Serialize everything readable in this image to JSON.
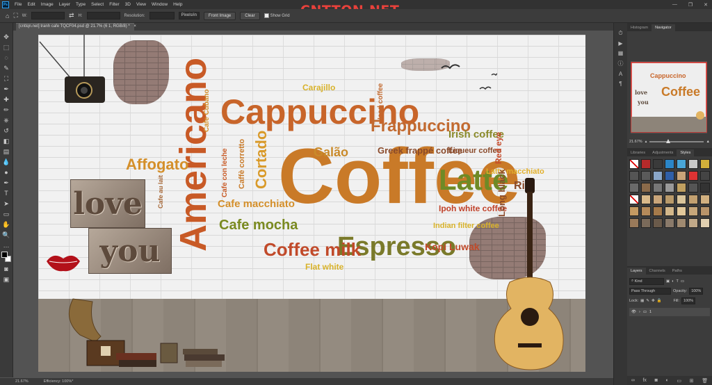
{
  "menu": [
    "File",
    "Edit",
    "Image",
    "Layer",
    "Type",
    "Select",
    "Filter",
    "3D",
    "View",
    "Window",
    "Help"
  ],
  "watermark": "CNTTQN.NET",
  "options": {
    "w_label": "W:",
    "h_label": "H:",
    "resolution_label": "Resolution:",
    "units": "Pixels/in",
    "front_image": "Front Image",
    "clear": "Clear",
    "show_grid": "Show Grid"
  },
  "document": {
    "tab_title": "[cnttqn.net] tranh cafe TQCF04.psd @ 21.7% (6 1, RGB/8) *",
    "close": "×"
  },
  "status": {
    "zoom": "21.67%",
    "efficiency": "Efficiency: 100%*"
  },
  "panels": {
    "top_tabs": [
      "Histogram",
      "Navigator"
    ],
    "zoom": "21.67%",
    "mid_tabs": [
      "Libraries",
      "Adjustments",
      "Styles"
    ],
    "layer_tabs": [
      "Layers",
      "Channels",
      "Paths"
    ],
    "kind": "Kind",
    "blend": "Pass Through",
    "opacity_label": "Opacity:",
    "opacity": "100%",
    "lock_label": "Lock:",
    "fill_label": "Fill:",
    "fill": "100%",
    "layer_name": "1"
  },
  "artwork": {
    "words": {
      "coffee": "Coffee",
      "cappuccino": "Cappuccino",
      "americano": "Americano",
      "frappuccino": "Frappuccino",
      "espresso": "Espresso",
      "latte": "Latte",
      "coffee_milk": "Coffee milk",
      "cafe_mocha": "Cafe mocha",
      "cafe_macchiato": "Cafe macchiato",
      "affogato": "Affogato",
      "cortado": "Cortado",
      "galao": "Galão",
      "irish_coffee": "Irish coffee",
      "greek": "Greek frappé coffee",
      "liqueur": "Liqueur coffee",
      "red_eye": "Red eye",
      "latte_macchiato": "Latte macchiato",
      "ristretto": "Rist",
      "ipoh": "Ipoh white coffee",
      "indian": "Indian filter coffee",
      "long_black": "Long black",
      "kopi_luwak": "Kopi Luwak",
      "flat_white": "Flat white",
      "carajillo": "Carajillo",
      "cafe_cubano": "Cafe Cubano",
      "iced_coffee": "Iced coffee",
      "cafe_con_leche": "Cafe con leche",
      "caffe_corretto": "Caffè corretto",
      "cafe_au_lait": "Cafe au lait",
      "love": "love",
      "you": "you"
    }
  }
}
